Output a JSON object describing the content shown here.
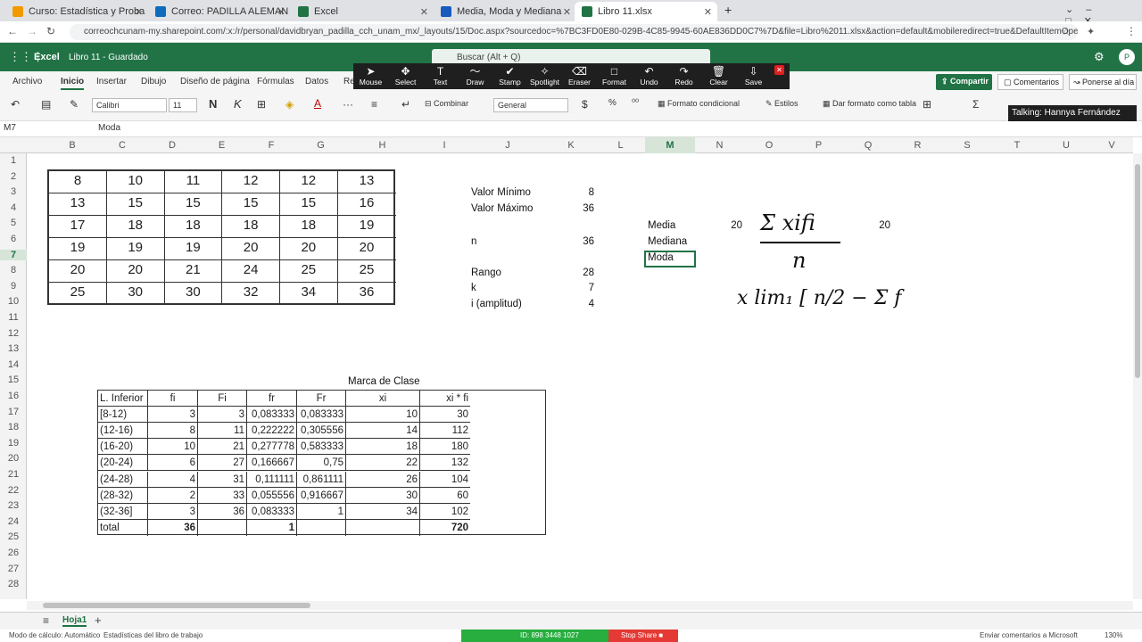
{
  "browser": {
    "tabs": [
      {
        "label": "Curso: Estadística y Proba",
        "icon_color": "#f29900"
      },
      {
        "label": "Correo: PADILLA ALEMAN",
        "icon_color": "#0f6cbd"
      },
      {
        "label": "Excel",
        "icon_color": "#217346"
      },
      {
        "label": "Media, Moda y Mediana",
        "icon_color": "#185abd"
      },
      {
        "label": "Libro 11.xlsx",
        "icon_color": "#217346"
      }
    ],
    "url": "correochcunam-my.sharepoint.com/:x:/r/personal/davidbryan_padilla_cch_unam_mx/_layouts/15/Doc.aspx?sourcedoc=%7BC3FD0E80-029B-4C85-9945-60AE836DD0C7%7D&file=Libro%2011.xlsx&action=default&mobileredirect=true&DefaultItemOpen=1&..."
  },
  "app": {
    "name": "Excel",
    "doc": "Libro 11 - Guardado",
    "search": "Buscar (Alt + Q)",
    "user_initial": "P",
    "share": "Compartir",
    "comments": "Comentarios",
    "catchup": "Ponerse al día",
    "talking": "Talking: Hannya Fernández"
  },
  "menu": [
    "Archivo",
    "Inicio",
    "Insertar",
    "Dibujo",
    "Diseño de página",
    "Fórmulas",
    "Datos",
    "Re"
  ],
  "toolbar": {
    "font": "Calibri",
    "size": "11",
    "merge": "Combinar",
    "format": "General",
    "cond": "Formato condicional",
    "styles": "Estilos",
    "table": "Dar formato como tabla"
  },
  "drawtools": [
    "Mouse",
    "Select",
    "Text",
    "Draw",
    "Stamp",
    "Spotlight",
    "Eraser",
    "Format",
    "Undo",
    "Redo",
    "Clear",
    "Save"
  ],
  "formula": {
    "cell": "M7",
    "value": "Moda"
  },
  "columns": [
    "B",
    "C",
    "D",
    "E",
    "F",
    "G",
    "H",
    "I",
    "J",
    "K",
    "L",
    "M",
    "N",
    "O",
    "P",
    "Q",
    "R",
    "S",
    "T",
    "U",
    "V"
  ],
  "rows": [
    "1",
    "2",
    "3",
    "4",
    "5",
    "6",
    "7",
    "8",
    "9",
    "10",
    "11",
    "12",
    "13",
    "14",
    "15",
    "16",
    "17",
    "18",
    "19",
    "20",
    "21",
    "22",
    "23",
    "24",
    "25",
    "26",
    "27",
    "28"
  ],
  "raw_grid": [
    [
      "8",
      "10",
      "11",
      "12",
      "12",
      "13"
    ],
    [
      "13",
      "15",
      "15",
      "15",
      "15",
      "16"
    ],
    [
      "17",
      "18",
      "18",
      "18",
      "18",
      "19"
    ],
    [
      "19",
      "19",
      "19",
      "20",
      "20",
      "20"
    ],
    [
      "20",
      "20",
      "21",
      "24",
      "25",
      "25"
    ],
    [
      "25",
      "30",
      "30",
      "32",
      "34",
      "36"
    ]
  ],
  "stats": [
    {
      "label": "Valor Mínimo",
      "value": "8"
    },
    {
      "label": "Valor Máximo",
      "value": "36"
    },
    {
      "label": "n",
      "value": "36"
    },
    {
      "label": "Rango",
      "value": "28"
    },
    {
      "label": "k",
      "value": "7"
    },
    {
      "label": "i (amplitud)",
      "value": "4"
    }
  ],
  "central": {
    "media_label": "Media",
    "media_value": "20",
    "mediana_label": "Mediana",
    "moda_label": "Moda",
    "extra_value": "20"
  },
  "freq": {
    "title": "Marca de Clase",
    "headers": [
      "L. Inferior",
      "fi",
      "Fi",
      "fr",
      "Fr",
      "xi",
      "xi * fi"
    ],
    "rows": [
      [
        "[8-12)",
        "3",
        "3",
        "0,083333",
        "0,083333",
        "10",
        "30"
      ],
      [
        "(12-16)",
        "8",
        "11",
        "0,222222",
        "0,305556",
        "14",
        "112"
      ],
      [
        "(16-20)",
        "10",
        "21",
        "0,277778",
        "0,583333",
        "18",
        "180"
      ],
      [
        "(20-24)",
        "6",
        "27",
        "0,166667",
        "0,75",
        "22",
        "132"
      ],
      [
        "(24-28)",
        "4",
        "31",
        "0,111111",
        "0,861111",
        "26",
        "104"
      ],
      [
        "(28-32)",
        "2",
        "33",
        "0,055556",
        "0,916667",
        "30",
        "60"
      ],
      [
        "(32-36]",
        "3",
        "36",
        "0,083333",
        "1",
        "34",
        "102"
      ]
    ],
    "total": [
      "total",
      "36",
      "",
      "1",
      "",
      "",
      "720"
    ]
  },
  "ink": {
    "formula_top": "Σ xifi",
    "formula_bottom": "n",
    "line2": "x  lim₁ [ n/2 − Σ f"
  },
  "sheet": {
    "tab": "Hoja1"
  },
  "status": {
    "left": "Modo de cálculo: Automático",
    "stats": "Estadísticas del libro de trabajo",
    "meeting_id": "ID: 898 3448 1027",
    "stop": "Stop Share",
    "feedback": "Enviar comentarios a Microsoft",
    "zoom": "130%"
  }
}
